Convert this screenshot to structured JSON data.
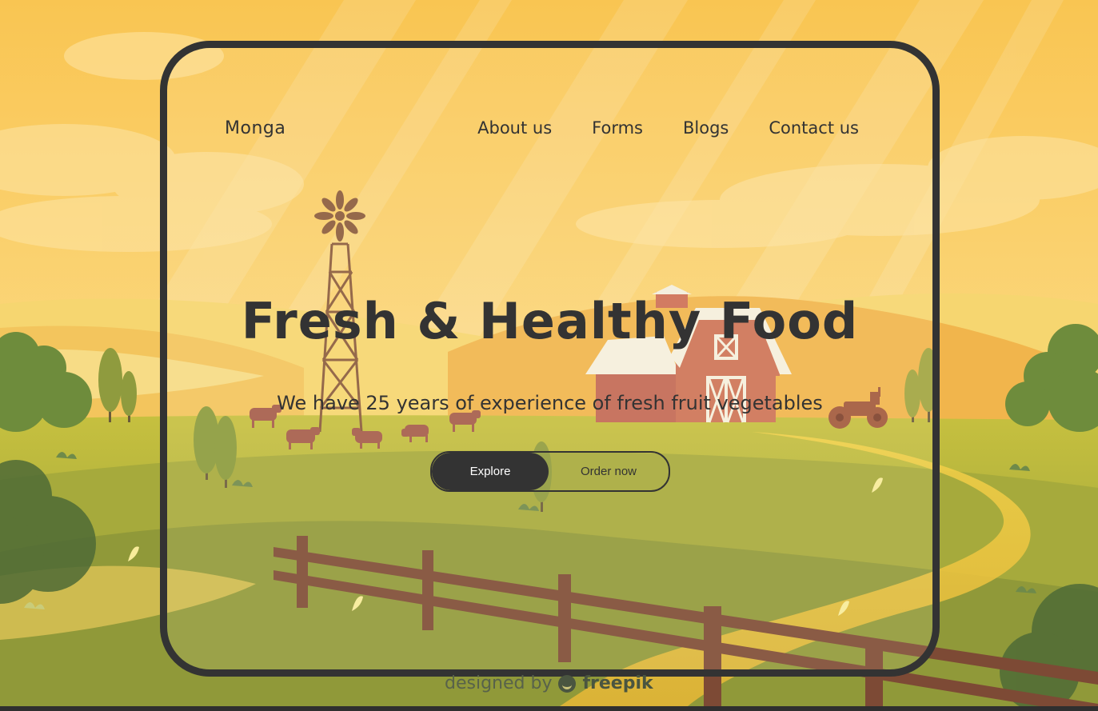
{
  "brand": "Monga",
  "nav": {
    "links": [
      "About us",
      "Forms",
      "Blogs",
      "Contact us"
    ]
  },
  "hero": {
    "title": "Fresh & Healthy Food",
    "subtitle": "We have 25 years of experience of fresh fruit vegetables"
  },
  "buttons": {
    "explore": "Explore",
    "order": "Order now"
  },
  "credit": {
    "prefix": "designed by",
    "brand": "freepik"
  },
  "colors": {
    "dark": "#333333",
    "sky": "#f8c44a",
    "field": "#b9b43a",
    "barn": "#cd7256"
  }
}
